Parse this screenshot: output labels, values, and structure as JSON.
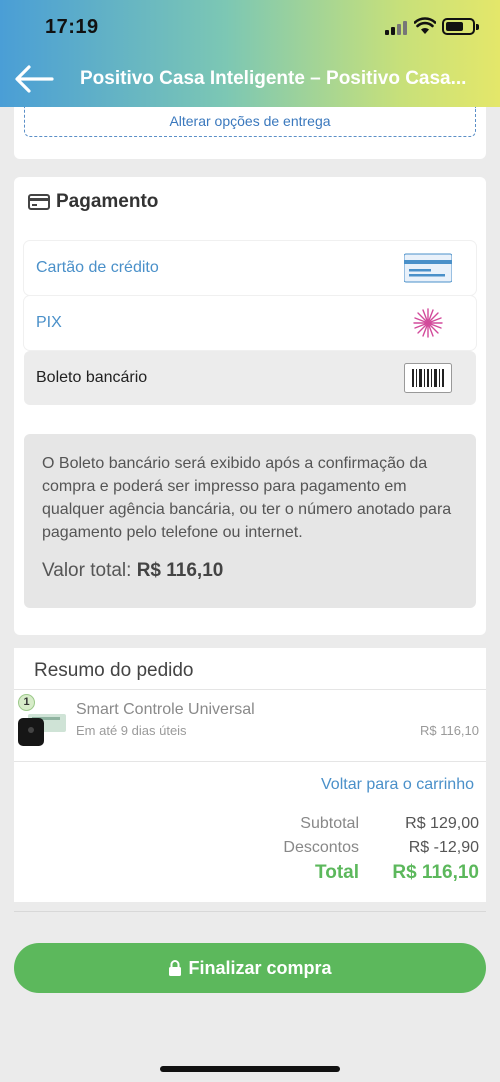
{
  "status_bar": {
    "time": "17:19"
  },
  "header": {
    "title": "Positivo Casa Inteligente – Positivo Casa...",
    "back_icon": "arrow-left-icon"
  },
  "delivery": {
    "alter_label": "Alterar opções de entrega"
  },
  "payment": {
    "title": "Pagamento",
    "icon": "credit-card-icon",
    "options": [
      {
        "label": "Cartão de crédito",
        "icon": "credit-card-icon",
        "selected": false
      },
      {
        "label": "PIX",
        "icon": "pix-icon",
        "selected": false
      },
      {
        "label": "Boleto bancário",
        "icon": "barcode-icon",
        "selected": true
      }
    ],
    "info_text": "O Boleto bancário será exibido após a confirmação da compra e poderá ser impresso para pagamento em qualquer agência bancária, ou ter o número anotado para pagamento pelo telefone ou internet.",
    "total_label": "Valor total:",
    "total_value": "R$ 116,10"
  },
  "summary": {
    "title": "Resumo do pedido",
    "item": {
      "quantity": "1",
      "name": "Smart Controle Universal",
      "delivery": "Em até 9 dias úteis",
      "price": "R$ 116,10"
    },
    "back_to_cart": "Voltar para o carrinho",
    "subtotal_label": "Subtotal",
    "subtotal_value": "R$ 129,00",
    "discounts_label": "Descontos",
    "discounts_value": "R$ -12,90",
    "total_label": "Total",
    "total_value": "R$ 116,10"
  },
  "cta": {
    "label": "Finalizar compra",
    "icon": "lock-icon"
  },
  "colors": {
    "accent_blue": "#4a90c9",
    "green": "#5cb85c"
  }
}
